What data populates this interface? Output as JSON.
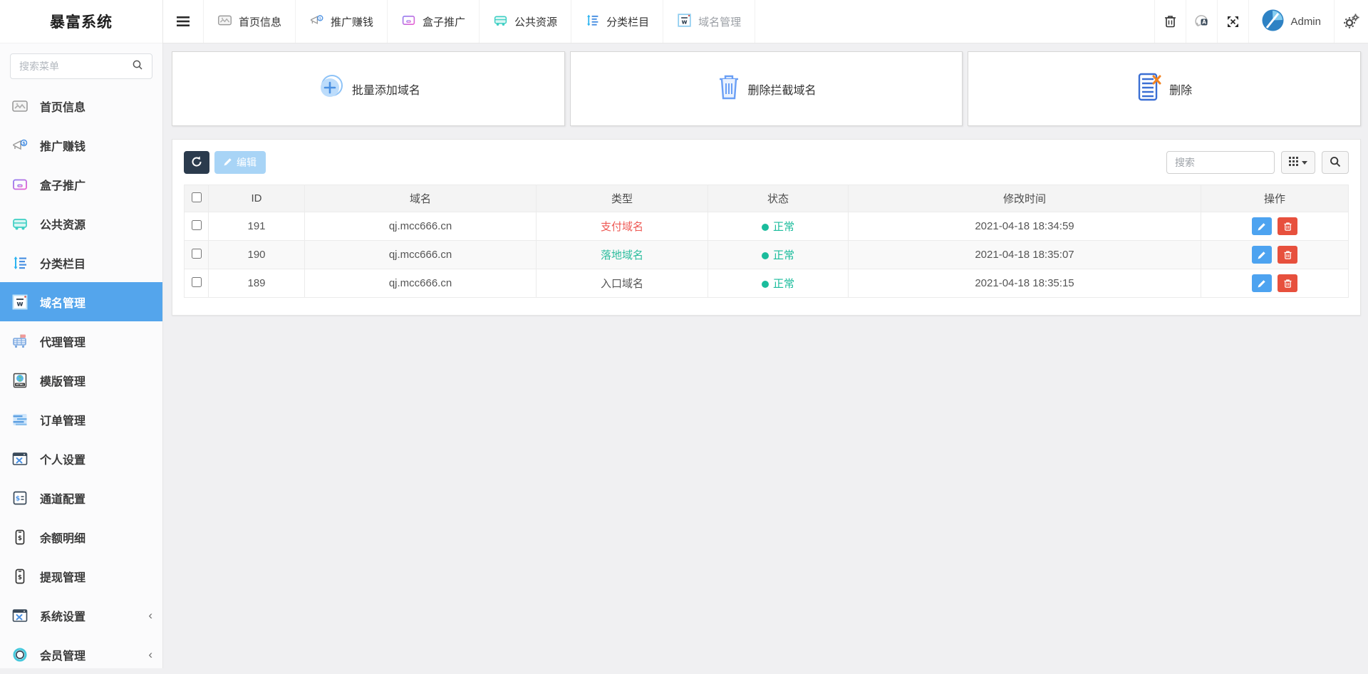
{
  "app": {
    "title": "暴富系统"
  },
  "sidebar": {
    "search_placeholder": "搜索菜单",
    "items": [
      {
        "label": "首页信息",
        "icon": "home-info-icon"
      },
      {
        "label": "推广赚钱",
        "icon": "megaphone-money-icon"
      },
      {
        "label": "盒子推广",
        "icon": "box-icon"
      },
      {
        "label": "公共资源",
        "icon": "bus-icon"
      },
      {
        "label": "分类栏目",
        "icon": "sort-list-icon"
      },
      {
        "label": "域名管理",
        "icon": "domain-w-icon",
        "active": true
      },
      {
        "label": "代理管理",
        "icon": "agent-cart-icon"
      },
      {
        "label": "模版管理",
        "icon": "template-html-icon"
      },
      {
        "label": "订单管理",
        "icon": "orders-icon"
      },
      {
        "label": "个人设置",
        "icon": "window-tools-icon"
      },
      {
        "label": "通道配置",
        "icon": "channel-config-icon"
      },
      {
        "label": "余额明细",
        "icon": "phone-dollar-icon"
      },
      {
        "label": "提现管理",
        "icon": "phone-dollar-icon"
      },
      {
        "label": "系统设置",
        "icon": "window-tools-icon",
        "chevron": "‹"
      },
      {
        "label": "会员管理",
        "icon": "member-ring-icon",
        "chevron": "‹"
      }
    ]
  },
  "topbar": {
    "tabs": [
      {
        "label": "首页信息",
        "icon": "home-info-icon"
      },
      {
        "label": "推广赚钱",
        "icon": "megaphone-money-icon"
      },
      {
        "label": "盒子推广",
        "icon": "box-icon"
      },
      {
        "label": "公共资源",
        "icon": "bus-icon"
      },
      {
        "label": "分类栏目",
        "icon": "sort-list-icon"
      },
      {
        "label": "域名管理",
        "icon": "domain-w-icon",
        "active": true
      }
    ],
    "right_icons": [
      "trash-icon",
      "clear-cache-icon",
      "fullscreen-icon",
      "gears-icon"
    ],
    "user": {
      "name": "Admin",
      "avatar": "avatar-logo"
    }
  },
  "cards": [
    {
      "label": "批量添加域名",
      "icon": "plus-circle-icon"
    },
    {
      "label": "删除拦截域名",
      "icon": "trash-blue-icon"
    },
    {
      "label": "删除",
      "icon": "doc-x-icon"
    }
  ],
  "toolbar": {
    "refresh_icon": "refresh-icon",
    "edit_label": "编辑",
    "search_placeholder": "搜索",
    "grid_icon": "grid-columns-icon",
    "search_icon": "search-icon"
  },
  "table": {
    "columns": {
      "id": "ID",
      "domain": "域名",
      "type": "类型",
      "status": "状态",
      "time": "修改时间",
      "actions": "操作"
    },
    "rows": [
      {
        "id": "191",
        "domain": "qj.mcc666.cn",
        "type": "支付域名",
        "type_color": "#ee5a55",
        "status": "正常",
        "time": "2021-04-18 18:34:59"
      },
      {
        "id": "190",
        "domain": "qj.mcc666.cn",
        "type": "落地域名",
        "type_color": "#2dbd9e",
        "status": "正常",
        "time": "2021-04-18 18:35:07"
      },
      {
        "id": "189",
        "domain": "qj.mcc666.cn",
        "type": "入口域名",
        "type_color": "#555555",
        "status": "正常",
        "time": "2021-04-18 18:35:15"
      }
    ]
  },
  "colors": {
    "accent_blue": "#54a5ec",
    "status_green": "#1abc9c",
    "type_red": "#ee5a55",
    "type_teal": "#2dbd9e",
    "dark_button": "#2b3b4d",
    "edit_disabled": "#a8d4f6",
    "action_edit_blue": "#4da3f0",
    "action_delete_red": "#e7503d",
    "page_background": "#f0f0f2"
  }
}
